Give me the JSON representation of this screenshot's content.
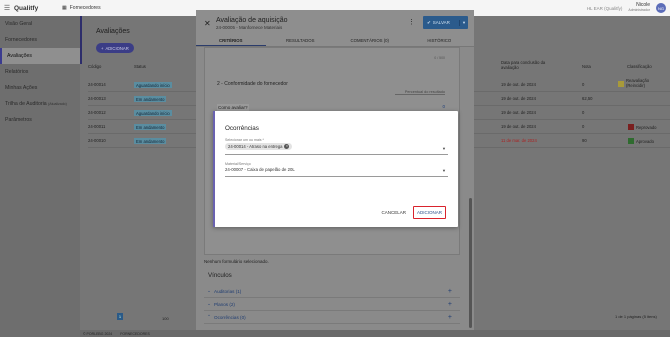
{
  "topbar": {
    "logo": "Qualitfy",
    "module": "Fornecedores",
    "env": "HL EAR (Qualitfy)",
    "user_name": "Nicole",
    "user_role": "Administrador",
    "avatar": "NG"
  },
  "sidebar": {
    "items": [
      {
        "label": "Visão Geral"
      },
      {
        "label": "Fornecedores"
      },
      {
        "label": "Avaliações"
      },
      {
        "label": "Relatórios"
      },
      {
        "label": "Minhas Ações"
      },
      {
        "label": "Trilha de Auditoria",
        "suffix": "(Atualizado)"
      },
      {
        "label": "Parâmetros"
      }
    ]
  },
  "page": {
    "title": "Avaliações",
    "add_button": "ADICIONAR",
    "columns": {
      "codigo": "Código",
      "status": "Status",
      "data": "Data para conclusão da avaliação",
      "nota": "Nota",
      "classificacao": "Classificação"
    },
    "rows": [
      {
        "code": "24-00014",
        "status": "Aguardando início",
        "date": "19 de out. de 2024",
        "grade": "0",
        "class": "Reavaliação (Reincidir)",
        "class_color": "#a89a3a",
        "date_red": false
      },
      {
        "code": "24-00013",
        "status": "Em andamento",
        "date": "19 de out. de 2024",
        "grade": "62,50",
        "class": "",
        "class_color": "",
        "date_red": false
      },
      {
        "code": "24-00012",
        "status": "Aguardando início",
        "date": "19 de out. de 2024",
        "grade": "0",
        "class": "",
        "class_color": "",
        "date_red": false
      },
      {
        "code": "24-00011",
        "status": "Em andamento",
        "date": "19 de out. de 2024",
        "grade": "0",
        "class": "Reprovado",
        "class_color": "#7a1f1f",
        "date_red": false
      },
      {
        "code": "24-00010",
        "status": "Em andamento",
        "date": "11 de mar. de 2024",
        "grade": "90",
        "class": "Aprovado",
        "class_color": "#2f6b2f",
        "date_red": true
      }
    ],
    "pagination": {
      "current": "1",
      "per_page": "100",
      "summary": "1 de 1 páginas (5 itens)"
    },
    "footer": {
      "left": "© PORLEBG 2024",
      "right": "FORNECEDORES"
    }
  },
  "modal": {
    "title": "Avaliação de aquisição",
    "subtitle": "24-00005 - Manfornece Materiais",
    "save_label": "SALVAR",
    "tabs": [
      "CRITÉRIOS",
      "RESULTADOS",
      "COMENTÁRIOS (0)",
      "HISTÓRICO"
    ],
    "counter": "0 / 500",
    "section": "2 - Conformidade do fornecedor",
    "percent_label": "Percentual do resultado",
    "how_label": "Como avaliar?",
    "number": "0",
    "obs_label": "Observações",
    "no_form": "Nenhum formulário selecionado.",
    "vinculos_title": "Vínculos",
    "vinculos": [
      {
        "label": "Auditorias (1)",
        "expanded": false
      },
      {
        "label": "Planos (2)",
        "expanded": false
      },
      {
        "label": "Ocorrências (0)",
        "expanded": true
      }
    ]
  },
  "dialog": {
    "title": "Ocorrências",
    "field1_label": "Selecionar um ou mais *",
    "field1_chip": "24-00014 - Atraso na entrega",
    "field2_label": "Material/Serviço",
    "field2_value": "24-00007 - Caixa de papelão de 20L",
    "cancel": "CANCELAR",
    "add": "ADICIONAR"
  },
  "colors": {
    "primary": "#2b5b8c",
    "accent_purple": "#6a62b0",
    "highlight_red": "#d9232d"
  }
}
